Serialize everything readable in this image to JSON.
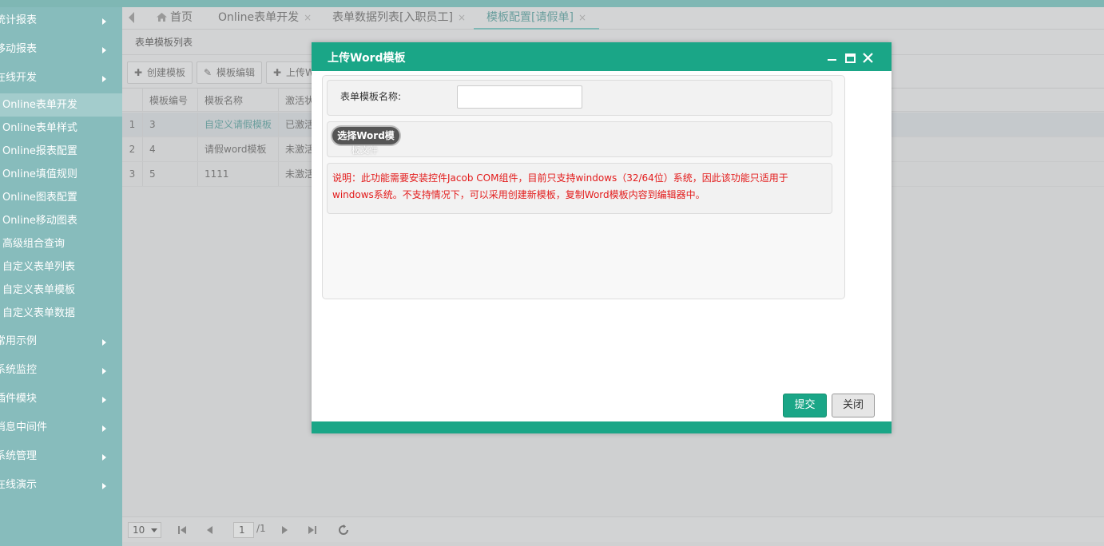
{
  "colors": {
    "accent": "#1aa687",
    "sidebar_bg": "#87bcbc",
    "note_red": "#e31b1b"
  },
  "sidebar": {
    "groups_top": [
      {
        "label": "统计报表"
      },
      {
        "label": "移动报表"
      },
      {
        "label": "在线开发"
      }
    ],
    "sub_items": [
      {
        "label": "Online表单开发",
        "active": true
      },
      {
        "label": "Online表单样式"
      },
      {
        "label": "Online报表配置"
      },
      {
        "label": "Online填值规则"
      },
      {
        "label": "Online图表配置"
      },
      {
        "label": "Online移动图表"
      },
      {
        "label": "高级组合查询"
      },
      {
        "label": "自定义表单列表"
      },
      {
        "label": "自定义表单模板"
      },
      {
        "label": "自定义表单数据"
      }
    ],
    "groups_bottom": [
      {
        "label": "常用示例"
      },
      {
        "label": "系统监控"
      },
      {
        "label": "插件模块"
      },
      {
        "label": "消息中间件"
      },
      {
        "label": "系统管理"
      },
      {
        "label": "在线演示"
      }
    ]
  },
  "tabs": [
    {
      "label": "首页",
      "icon": "home-icon"
    },
    {
      "label": "Online表单开发"
    },
    {
      "label": "表单数据列表[入职员工]"
    },
    {
      "label": "模板配置[请假单]",
      "active": true
    }
  ],
  "tab_close": "×",
  "panel": {
    "title": "表单模板列表"
  },
  "toolbar": {
    "create": "创建模板",
    "edit": "模板编辑",
    "upload": "上传W"
  },
  "grid": {
    "headers": [
      "模板编号",
      "模板名称",
      "激活状"
    ],
    "rows": [
      {
        "rn": "1",
        "id": "3",
        "name": "自定义请假模板",
        "status": "已激活"
      },
      {
        "rn": "2",
        "id": "4",
        "name": "请假word模板",
        "status": "未激活"
      },
      {
        "rn": "3",
        "id": "5",
        "name": "1111",
        "status": "未激活"
      }
    ]
  },
  "pager": {
    "page_size": "10",
    "current_page": "1",
    "total_pages": "/1"
  },
  "modal": {
    "title": "上传Word模板",
    "field_label": "表单模板名称:",
    "field_value": "",
    "upload_button": "选择Word模",
    "upload_button_tail": "板文件",
    "note": "说明：此功能需要安装控件Jacob COM组件，目前只支持windows（32/64位）系统，因此该功能只适用于windows系统。不支持情况下，可以采用创建新模板，复制Word模板内容到编辑器中。",
    "submit": "提交",
    "close": "关闭"
  }
}
